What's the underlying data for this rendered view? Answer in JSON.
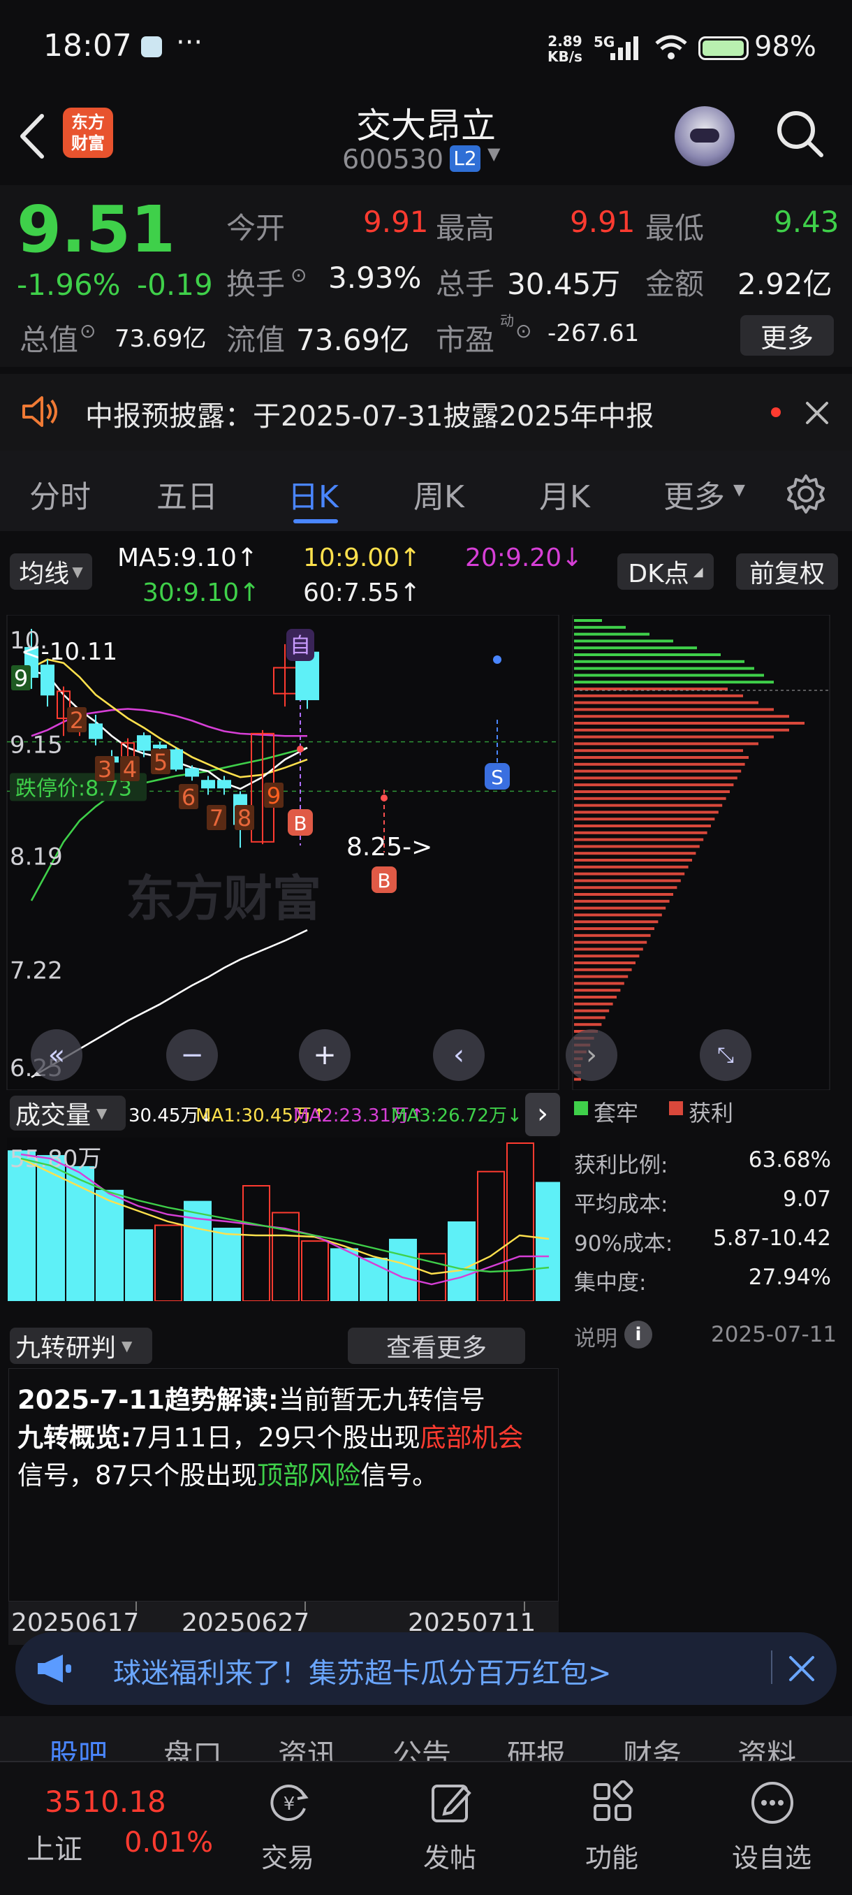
{
  "status": {
    "time": "18:07",
    "dots": "···",
    "speed_top": "2.89",
    "speed_bottom": "KB/s",
    "net": "5G",
    "battery": "98%"
  },
  "header": {
    "logo_line1": "东方",
    "logo_line2": "财富",
    "title": "交大昂立",
    "code": "600530",
    "badge": "L2"
  },
  "quote": {
    "price": "9.51",
    "change_pct": "-1.96%",
    "change": "-0.19",
    "open_label": "今开",
    "open": "9.91",
    "high_label": "最高",
    "high": "9.91",
    "low_label": "最低",
    "low": "9.43",
    "turnover_label": "换手",
    "turnover": "3.93%",
    "volume_label": "总手",
    "volume": "30.45万",
    "amount_label": "金额",
    "amount": "2.92亿",
    "mktcap_label": "总值",
    "mktcap": "73.69亿",
    "float_label": "流值",
    "float": "73.69亿",
    "pe_label": "市盈",
    "pe_sup": "动",
    "pe": "-267.61",
    "more_label": "更多"
  },
  "notice": {
    "text": "中报预披露：于2025-07-31披露2025年中报"
  },
  "tabs": {
    "items": [
      "分时",
      "五日",
      "日K",
      "周K",
      "月K",
      "更多"
    ],
    "active": "日K"
  },
  "ma_bar": {
    "ma_label": "均线",
    "ma5": "MA5:9.10↑",
    "ma10": "10:9.00↑",
    "ma20": "20:9.20↓",
    "ma30": "30:9.10↑",
    "ma60": "60:7.55↑",
    "dk_label": "DK点",
    "fq_label": "前复权"
  },
  "kchart": {
    "y_labels": [
      "10.11",
      "9.15",
      "8.19",
      "7.22",
      "6.25"
    ],
    "y_label_top": "10.",
    "limit_down": "跌停价:8.73",
    "annotation_high": "<-10.11",
    "annotation_low": "8.25->",
    "badge_self": "自",
    "badge_b": "B",
    "badge_s": "S",
    "nine_counts": [
      "9",
      "2",
      "3",
      "4",
      "5",
      "6",
      "7",
      "8",
      "9"
    ],
    "watermark": "东方财富",
    "colors": {
      "up": "#ff3b30",
      "down": "#5ef0f7",
      "ma5": "#ffffff",
      "ma10": "#ffe14d",
      "ma20": "#d63fd6",
      "ma30": "#3fd04a",
      "ma60": "#ffffff"
    }
  },
  "chart_data": {
    "type": "candlestick",
    "x_labels": [
      "20250617",
      "20250627",
      "20250711"
    ],
    "ylim": [
      6.25,
      10.11
    ],
    "candles": [
      {
        "o": 9.95,
        "c": 9.7,
        "h": 10.11,
        "l": 9.6
      },
      {
        "o": 9.8,
        "c": 9.55,
        "h": 9.85,
        "l": 9.45
      },
      {
        "o": 9.35,
        "c": 9.58,
        "h": 9.62,
        "l": 9.2
      },
      {
        "o": 9.28,
        "c": 9.3,
        "h": 9.32,
        "l": 9.2
      },
      {
        "o": 9.3,
        "c": 9.18,
        "h": 9.38,
        "l": 9.12
      },
      {
        "o": 9.02,
        "c": 8.98,
        "h": 9.08,
        "l": 8.92
      },
      {
        "o": 8.88,
        "c": 9.14,
        "h": 9.18,
        "l": 8.85
      },
      {
        "o": 9.2,
        "c": 9.08,
        "h": 9.23,
        "l": 9.02
      },
      {
        "o": 9.12,
        "c": 9.1,
        "h": 9.15,
        "l": 8.99
      },
      {
        "o": 9.08,
        "c": 8.92,
        "h": 9.1,
        "l": 8.9
      },
      {
        "o": 8.92,
        "c": 8.86,
        "h": 8.95,
        "l": 8.82
      },
      {
        "o": 8.82,
        "c": 8.76,
        "h": 8.86,
        "l": 8.7
      },
      {
        "o": 8.82,
        "c": 8.76,
        "h": 8.86,
        "l": 8.7
      },
      {
        "o": 8.7,
        "c": 8.45,
        "h": 8.73,
        "l": 8.25
      },
      {
        "o": 8.3,
        "c": 9.22,
        "h": 9.25,
        "l": 8.28
      },
      {
        "o": 9.56,
        "c": 9.78,
        "h": 9.98,
        "l": 9.45
      },
      {
        "o": 9.91,
        "c": 9.51,
        "h": 9.91,
        "l": 9.43
      }
    ],
    "ma5": [
      9.75,
      9.72,
      9.55,
      9.42,
      9.32,
      9.2,
      9.1,
      9.05,
      9.02,
      8.98,
      8.93,
      8.9,
      8.8,
      8.75,
      8.85,
      9.0,
      9.1
    ],
    "ma10": [
      9.78,
      9.85,
      9.82,
      9.7,
      9.55,
      9.45,
      9.35,
      9.27,
      9.18,
      9.1,
      9.02,
      8.96,
      8.9,
      8.85,
      8.87,
      8.93,
      9.0
    ],
    "ma20": [
      9.2,
      9.25,
      9.32,
      9.38,
      9.4,
      9.42,
      9.43,
      9.42,
      9.4,
      9.37,
      9.33,
      9.28,
      9.24,
      9.22,
      9.21,
      9.2,
      9.2
    ],
    "ma30": [
      7.8,
      8.05,
      8.3,
      8.48,
      8.6,
      8.7,
      8.76,
      8.8,
      8.83,
      8.86,
      8.88,
      8.9,
      8.93,
      8.96,
      9.0,
      9.05,
      9.1
    ],
    "ma60": [
      6.3,
      6.38,
      6.46,
      6.54,
      6.62,
      6.7,
      6.78,
      6.85,
      6.92,
      7.0,
      7.08,
      7.15,
      7.23,
      7.3,
      7.38,
      7.46,
      7.55
    ]
  },
  "volume": {
    "label": "成交量",
    "value_text": "30.45万↓",
    "ma1": "MA1:30.45万↑",
    "ma2": "MA2:23.31万↑",
    "ma3": "MA3:26.72万↓",
    "max_label": "55.80万",
    "bars": [
      {
        "v": 0.95,
        "up": false
      },
      {
        "v": 0.92,
        "up": false
      },
      {
        "v": 0.85,
        "up": false
      },
      {
        "v": 0.7,
        "up": false
      },
      {
        "v": 0.45,
        "up": false
      },
      {
        "v": 0.48,
        "up": true
      },
      {
        "v": 0.63,
        "up": false
      },
      {
        "v": 0.46,
        "up": false
      },
      {
        "v": 0.73,
        "up": true
      },
      {
        "v": 0.56,
        "up": true
      },
      {
        "v": 0.38,
        "up": true
      },
      {
        "v": 0.33,
        "up": false
      },
      {
        "v": 0.27,
        "up": false
      },
      {
        "v": 0.39,
        "up": false
      },
      {
        "v": 0.3,
        "up": true
      },
      {
        "v": 0.5,
        "up": false
      },
      {
        "v": 0.82,
        "up": true
      },
      {
        "v": 1.0,
        "up": true
      },
      {
        "v": 0.75,
        "up": false
      }
    ]
  },
  "chips": {
    "legend_trap": "套牢",
    "legend_profit": "获利",
    "rows": [
      {
        "label": "获利比例:",
        "value": "63.68%"
      },
      {
        "label": "平均成本:",
        "value": "9.07"
      },
      {
        "label": "90%成本:",
        "value": "5.87-10.42"
      },
      {
        "label": "集中度:",
        "value": "27.94%"
      }
    ],
    "note_label": "说明",
    "date": "2025-07-11"
  },
  "nine": {
    "label": "九转研判",
    "more": "查看更多",
    "line1_bold": "2025-7-11趋势解读:",
    "line1_rest": "当前暂无九转信号",
    "line2_bold": "九转概览:",
    "line2_a": "7月11日，29只个股出现",
    "line2_red": "底部机会",
    "line3_a": "信号，87只个股出现",
    "line3_green": "顶部风险",
    "line3_b": "信号。"
  },
  "dates": [
    "20250617",
    "20250627",
    "20250711"
  ],
  "banner": {
    "text": "球迷福利来了！集苏超卡瓜分百万红包>"
  },
  "subtabs": [
    "股吧",
    "盘口",
    "资讯",
    "公告",
    "研报",
    "财务",
    "资料"
  ],
  "bottom": {
    "index_value": "3510.18",
    "index_name": "上证",
    "index_change": "0.01%",
    "nav": [
      "交易",
      "发帖",
      "功能",
      "设自选"
    ]
  }
}
